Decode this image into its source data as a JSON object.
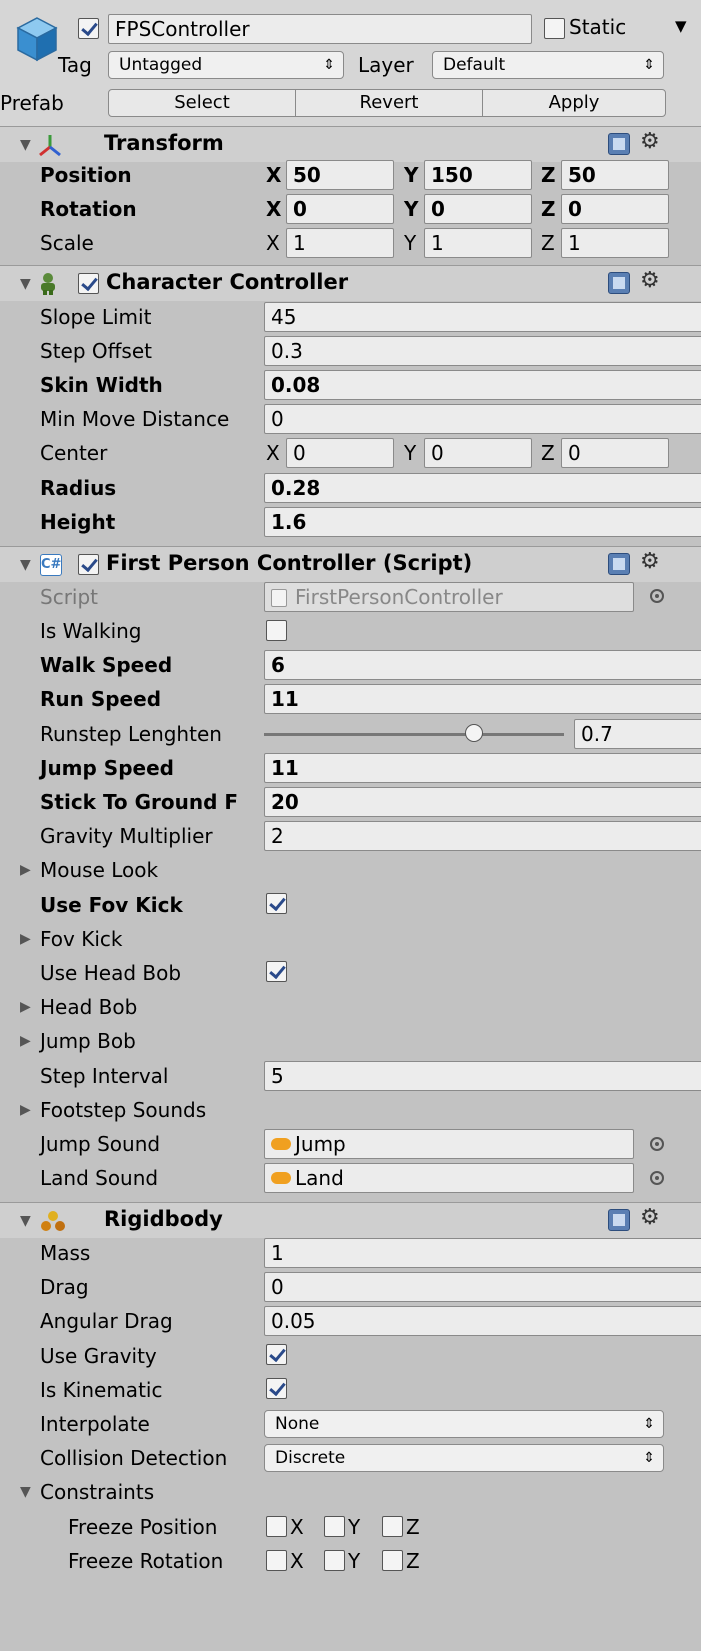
{
  "header": {
    "name": "FPSController",
    "static_label": "Static",
    "tag_label": "Tag",
    "tag_value": "Untagged",
    "layer_label": "Layer",
    "layer_value": "Default",
    "prefab_label": "Prefab",
    "select_label": "Select",
    "revert_label": "Revert",
    "apply_label": "Apply"
  },
  "transform": {
    "title": "Transform",
    "position_label": "Position",
    "rotation_label": "Rotation",
    "scale_label": "Scale",
    "position": {
      "x": "50",
      "y": "150",
      "z": "50"
    },
    "rotation": {
      "x": "0",
      "y": "0",
      "z": "0"
    },
    "scale": {
      "x": "1",
      "y": "1",
      "z": "1"
    }
  },
  "axes": {
    "x": "X",
    "y": "Y",
    "z": "Z"
  },
  "character_controller": {
    "title": "Character Controller",
    "slope_limit_label": "Slope Limit",
    "slope_limit": "45",
    "step_offset_label": "Step Offset",
    "step_offset": "0.3",
    "skin_width_label": "Skin Width",
    "skin_width": "0.08",
    "min_move_label": "Min Move Distance",
    "min_move": "0",
    "center_label": "Center",
    "center": {
      "x": "0",
      "y": "0",
      "z": "0"
    },
    "radius_label": "Radius",
    "radius": "0.28",
    "height_label": "Height",
    "height": "1.6"
  },
  "fps_script": {
    "title": "First Person Controller (Script)",
    "script_label": "Script",
    "script_value": "FirstPersonController",
    "is_walking_label": "Is Walking",
    "walk_speed_label": "Walk Speed",
    "walk_speed": "6",
    "run_speed_label": "Run Speed",
    "run_speed": "11",
    "runstep_label": "Runstep Lenghten",
    "runstep": "0.7",
    "runstep_fraction": 0.7,
    "jump_speed_label": "Jump Speed",
    "jump_speed": "11",
    "stick_label": "Stick To Ground F",
    "stick": "20",
    "gravity_label": "Gravity Multiplier",
    "gravity": "2",
    "mouse_look_label": "Mouse Look",
    "use_fov_kick_label": "Use Fov Kick",
    "fov_kick_label": "Fov Kick",
    "use_head_bob_label": "Use Head Bob",
    "head_bob_label": "Head Bob",
    "jump_bob_label": "Jump Bob",
    "step_interval_label": "Step Interval",
    "step_interval": "5",
    "footstep_label": "Footstep Sounds",
    "jump_sound_label": "Jump Sound",
    "jump_sound": "Jump",
    "land_sound_label": "Land Sound",
    "land_sound": "Land"
  },
  "rigidbody": {
    "title": "Rigidbody",
    "mass_label": "Mass",
    "mass": "1",
    "drag_label": "Drag",
    "drag": "0",
    "angular_drag_label": "Angular Drag",
    "angular_drag": "0.05",
    "use_gravity_label": "Use Gravity",
    "is_kinematic_label": "Is Kinematic",
    "interpolate_label": "Interpolate",
    "interpolate": "None",
    "collision_label": "Collision Detection",
    "collision": "Discrete",
    "constraints_label": "Constraints",
    "freeze_position_label": "Freeze Position",
    "freeze_rotation_label": "Freeze Rotation"
  },
  "colors": {
    "accent": "#2a4a8a",
    "panel": "#c2c2c2",
    "header": "#cfcfcf",
    "field": "#ececec"
  }
}
